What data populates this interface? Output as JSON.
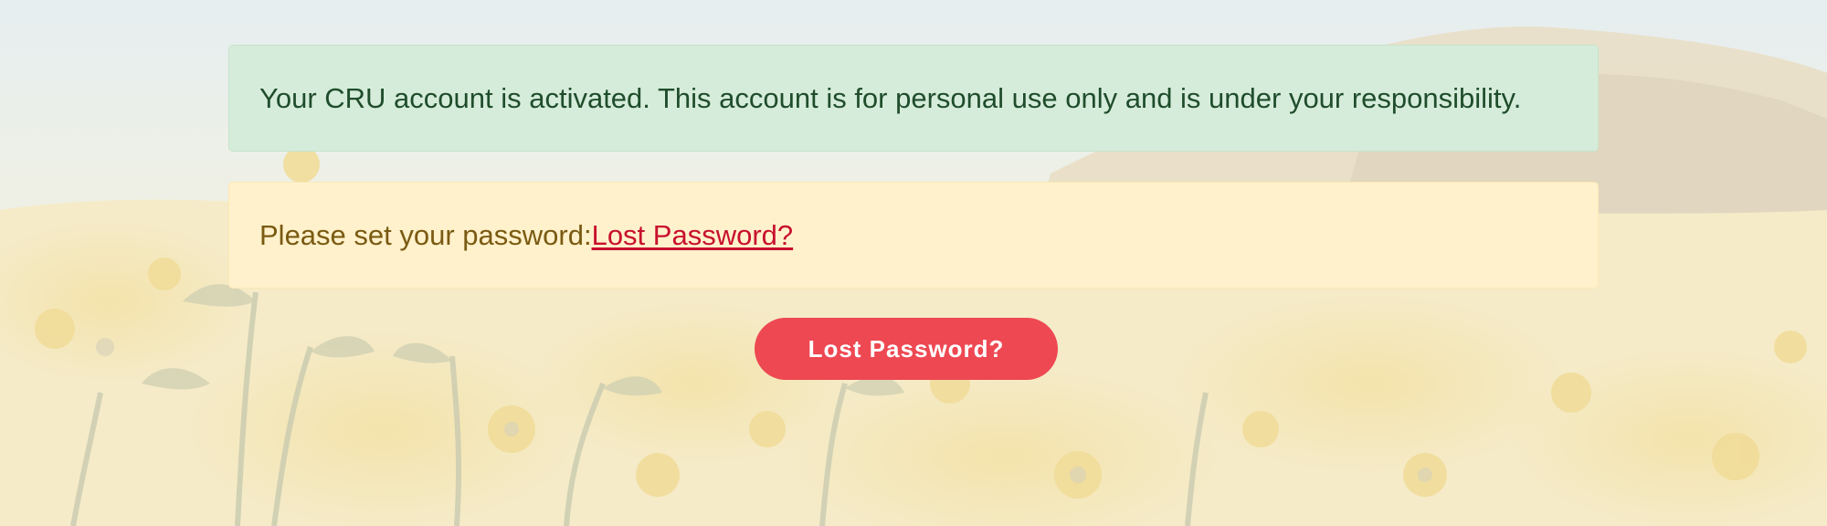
{
  "alerts": {
    "success": {
      "text": "Your CRU account is activated. This account is for personal use only and is under your responsibility."
    },
    "warning": {
      "text": "Please set your password:",
      "link_label": "Lost Password?"
    }
  },
  "actions": {
    "lost_password_button": "Lost Password?"
  },
  "colors": {
    "success_bg": "#d6ecdb",
    "success_text": "#1f4d2b",
    "warning_bg": "#fff1cb",
    "warning_text": "#7a5a12",
    "link": "#c8102e",
    "button_bg": "#ee4852"
  }
}
